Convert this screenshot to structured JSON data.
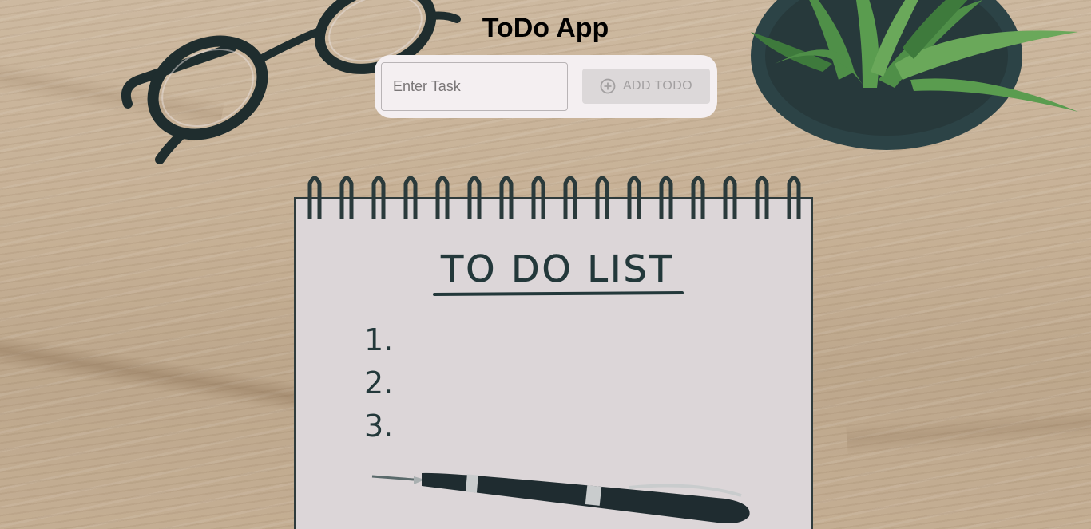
{
  "app": {
    "title": "ToDo App"
  },
  "form": {
    "input_placeholder": "Enter Task",
    "input_value": "",
    "add_button_label": "ADD TODO",
    "add_button_icon": "plus-circle-icon"
  },
  "background": {
    "notebook_heading": "TO DO LIST",
    "notebook_items": [
      "1.",
      "2.",
      "3."
    ]
  },
  "colors": {
    "card_bg": "#f4eff1",
    "button_disabled_bg": "#dcd8d9",
    "button_disabled_text": "#a3a0a1",
    "ink": "#23383a"
  }
}
